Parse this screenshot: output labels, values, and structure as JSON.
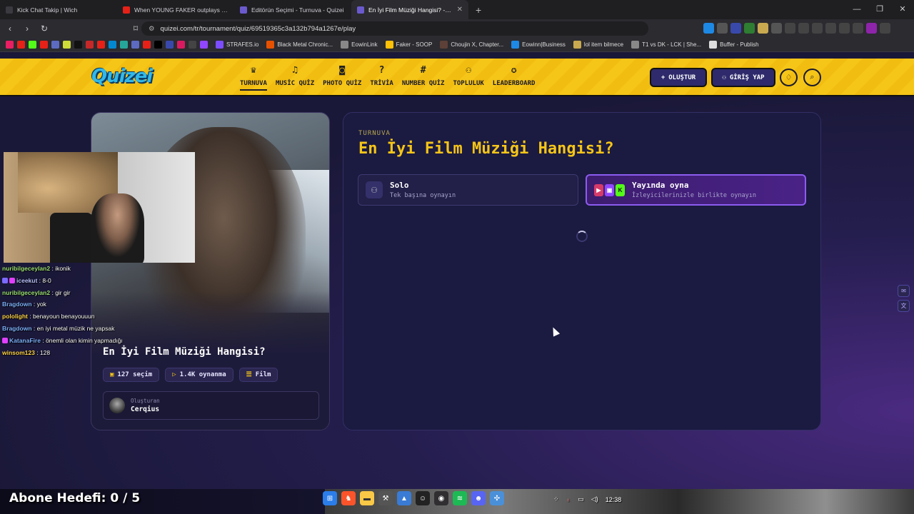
{
  "browser": {
    "tabs": [
      {
        "title": "Kick Chat Takip | Wich",
        "color": "#2b2b30"
      },
      {
        "title": "When YOUNG FAKER outplays every",
        "color": "#e62117"
      },
      {
        "title": "Editörün Seçimi - Turnuva - Quizei",
        "color": "#2b2b30"
      },
      {
        "title": "En İyi Film Müziği Hangisi? - Tier",
        "color": "#2b2b30"
      }
    ],
    "new_tab": "+",
    "url": "quizei.com/tr/tournament/quiz/69519365c3a132b794a1267e/play",
    "bookmarks": [
      {
        "label": "STRAFES.io",
        "color": "#7c4dff"
      },
      {
        "label": "Black Metal Chronic...",
        "color": "#e65100"
      },
      {
        "label": "EowinLink",
        "color": "#888888"
      },
      {
        "label": "Faker - SOOP",
        "color": "#ffc107"
      },
      {
        "label": "Choujin X, Chapter...",
        "color": "#5d4037"
      },
      {
        "label": "Eowinn|Business",
        "color": "#1e88e5"
      },
      {
        "label": "lol item bilmece",
        "color": "#c8a94f"
      },
      {
        "label": "T1 vs DK - LCK | She...",
        "color": "#888888"
      },
      {
        "label": "Buffer - Publish",
        "color": "#dddddd"
      }
    ]
  },
  "site": {
    "logo": "Quizei",
    "nav": [
      {
        "label": "TURNUVA",
        "icon": "trophy-icon",
        "glyph": "♛",
        "active": true
      },
      {
        "label": "MUSİC QUİZ",
        "icon": "music-icon",
        "glyph": "♫",
        "active": false
      },
      {
        "label": "PHOTO QUİZ",
        "icon": "camera-icon",
        "glyph": "◙",
        "active": false
      },
      {
        "label": "TRİVİA",
        "icon": "question-icon",
        "glyph": "?",
        "active": false
      },
      {
        "label": "NUMBER QUİZ",
        "icon": "hash-icon",
        "glyph": "#",
        "active": false
      },
      {
        "label": "TOPLULUK",
        "icon": "users-icon",
        "glyph": "⚇",
        "active": false
      },
      {
        "label": "LEADERBOARD",
        "icon": "medal-icon",
        "glyph": "✪",
        "active": false
      }
    ],
    "create_label": "OLUŞTUR",
    "login_label": "GİRİŞ YAP"
  },
  "quiz": {
    "card_title": "En İyi Film Müziği Hangisi?",
    "chips": [
      {
        "icon": "stack-icon",
        "glyph": "▣",
        "label": "127 seçim"
      },
      {
        "icon": "play-icon",
        "glyph": "▷",
        "label": "1.4K oynanma"
      },
      {
        "icon": "list-icon",
        "glyph": "☰",
        "label": "Film"
      }
    ],
    "creator_label": "Oluşturan",
    "creator_name": "Cerqius",
    "kicker": "TURNUVA",
    "title": "En İyi Film Müziği Hangisi?",
    "modes": {
      "solo": {
        "title": "Solo",
        "subtitle": "Tek başına oynayın"
      },
      "live": {
        "title": "Yayında oyna",
        "subtitle": "İzleyicilerinizle birlikte oynayın"
      }
    }
  },
  "stream": {
    "chat": [
      {
        "user": "nuribilgeceylan2",
        "msg": "ikonik",
        "color": "#9ce07a",
        "badge": null
      },
      {
        "user": "iceekut",
        "msg": "8-0",
        "color": "#b9c3ff",
        "badge": "#7c6bff"
      },
      {
        "user": "nuribilgeceylan2",
        "msg": "gir gir",
        "color": "#9ce07a",
        "badge": null
      },
      {
        "user": "Bragdown",
        "msg": "yok",
        "color": "#7fb2ff",
        "badge": null
      },
      {
        "user": "pololight",
        "msg": "benayoun benayouuun",
        "color": "#ffd54f",
        "badge": null
      },
      {
        "user": "Bragdown",
        "msg": "en iyi metal müzik ne yapsak",
        "color": "#7fb2ff",
        "badge": null
      },
      {
        "user": "KatanaFire",
        "msg": "önemli olan kimin yapmadığı",
        "color": "#7fb2ff",
        "badge": "#e040fb"
      },
      {
        "user": "winsom123",
        "msg": "128",
        "color": "#ffd54f",
        "badge": null
      }
    ],
    "goal": "Abone Hedefi:  0 / 5",
    "clock": "12:38"
  }
}
